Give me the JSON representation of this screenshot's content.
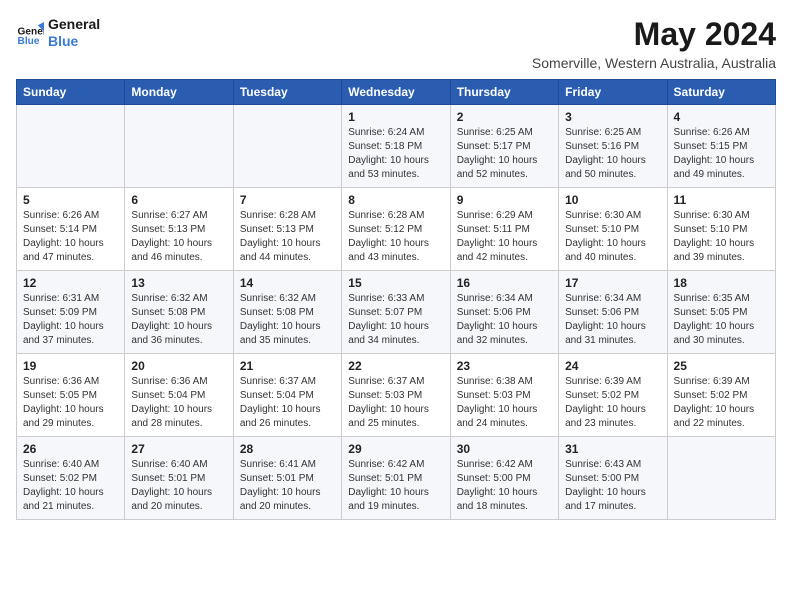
{
  "header": {
    "logo_line1": "General",
    "logo_line2": "Blue",
    "month_year": "May 2024",
    "location": "Somerville, Western Australia, Australia"
  },
  "weekdays": [
    "Sunday",
    "Monday",
    "Tuesday",
    "Wednesday",
    "Thursday",
    "Friday",
    "Saturday"
  ],
  "weeks": [
    [
      {
        "day": "",
        "info": ""
      },
      {
        "day": "",
        "info": ""
      },
      {
        "day": "",
        "info": ""
      },
      {
        "day": "1",
        "info": "Sunrise: 6:24 AM\nSunset: 5:18 PM\nDaylight: 10 hours and 53 minutes."
      },
      {
        "day": "2",
        "info": "Sunrise: 6:25 AM\nSunset: 5:17 PM\nDaylight: 10 hours and 52 minutes."
      },
      {
        "day": "3",
        "info": "Sunrise: 6:25 AM\nSunset: 5:16 PM\nDaylight: 10 hours and 50 minutes."
      },
      {
        "day": "4",
        "info": "Sunrise: 6:26 AM\nSunset: 5:15 PM\nDaylight: 10 hours and 49 minutes."
      }
    ],
    [
      {
        "day": "5",
        "info": "Sunrise: 6:26 AM\nSunset: 5:14 PM\nDaylight: 10 hours and 47 minutes."
      },
      {
        "day": "6",
        "info": "Sunrise: 6:27 AM\nSunset: 5:13 PM\nDaylight: 10 hours and 46 minutes."
      },
      {
        "day": "7",
        "info": "Sunrise: 6:28 AM\nSunset: 5:13 PM\nDaylight: 10 hours and 44 minutes."
      },
      {
        "day": "8",
        "info": "Sunrise: 6:28 AM\nSunset: 5:12 PM\nDaylight: 10 hours and 43 minutes."
      },
      {
        "day": "9",
        "info": "Sunrise: 6:29 AM\nSunset: 5:11 PM\nDaylight: 10 hours and 42 minutes."
      },
      {
        "day": "10",
        "info": "Sunrise: 6:30 AM\nSunset: 5:10 PM\nDaylight: 10 hours and 40 minutes."
      },
      {
        "day": "11",
        "info": "Sunrise: 6:30 AM\nSunset: 5:10 PM\nDaylight: 10 hours and 39 minutes."
      }
    ],
    [
      {
        "day": "12",
        "info": "Sunrise: 6:31 AM\nSunset: 5:09 PM\nDaylight: 10 hours and 37 minutes."
      },
      {
        "day": "13",
        "info": "Sunrise: 6:32 AM\nSunset: 5:08 PM\nDaylight: 10 hours and 36 minutes."
      },
      {
        "day": "14",
        "info": "Sunrise: 6:32 AM\nSunset: 5:08 PM\nDaylight: 10 hours and 35 minutes."
      },
      {
        "day": "15",
        "info": "Sunrise: 6:33 AM\nSunset: 5:07 PM\nDaylight: 10 hours and 34 minutes."
      },
      {
        "day": "16",
        "info": "Sunrise: 6:34 AM\nSunset: 5:06 PM\nDaylight: 10 hours and 32 minutes."
      },
      {
        "day": "17",
        "info": "Sunrise: 6:34 AM\nSunset: 5:06 PM\nDaylight: 10 hours and 31 minutes."
      },
      {
        "day": "18",
        "info": "Sunrise: 6:35 AM\nSunset: 5:05 PM\nDaylight: 10 hours and 30 minutes."
      }
    ],
    [
      {
        "day": "19",
        "info": "Sunrise: 6:36 AM\nSunset: 5:05 PM\nDaylight: 10 hours and 29 minutes."
      },
      {
        "day": "20",
        "info": "Sunrise: 6:36 AM\nSunset: 5:04 PM\nDaylight: 10 hours and 28 minutes."
      },
      {
        "day": "21",
        "info": "Sunrise: 6:37 AM\nSunset: 5:04 PM\nDaylight: 10 hours and 26 minutes."
      },
      {
        "day": "22",
        "info": "Sunrise: 6:37 AM\nSunset: 5:03 PM\nDaylight: 10 hours and 25 minutes."
      },
      {
        "day": "23",
        "info": "Sunrise: 6:38 AM\nSunset: 5:03 PM\nDaylight: 10 hours and 24 minutes."
      },
      {
        "day": "24",
        "info": "Sunrise: 6:39 AM\nSunset: 5:02 PM\nDaylight: 10 hours and 23 minutes."
      },
      {
        "day": "25",
        "info": "Sunrise: 6:39 AM\nSunset: 5:02 PM\nDaylight: 10 hours and 22 minutes."
      }
    ],
    [
      {
        "day": "26",
        "info": "Sunrise: 6:40 AM\nSunset: 5:02 PM\nDaylight: 10 hours and 21 minutes."
      },
      {
        "day": "27",
        "info": "Sunrise: 6:40 AM\nSunset: 5:01 PM\nDaylight: 10 hours and 20 minutes."
      },
      {
        "day": "28",
        "info": "Sunrise: 6:41 AM\nSunset: 5:01 PM\nDaylight: 10 hours and 20 minutes."
      },
      {
        "day": "29",
        "info": "Sunrise: 6:42 AM\nSunset: 5:01 PM\nDaylight: 10 hours and 19 minutes."
      },
      {
        "day": "30",
        "info": "Sunrise: 6:42 AM\nSunset: 5:00 PM\nDaylight: 10 hours and 18 minutes."
      },
      {
        "day": "31",
        "info": "Sunrise: 6:43 AM\nSunset: 5:00 PM\nDaylight: 10 hours and 17 minutes."
      },
      {
        "day": "",
        "info": ""
      }
    ]
  ]
}
